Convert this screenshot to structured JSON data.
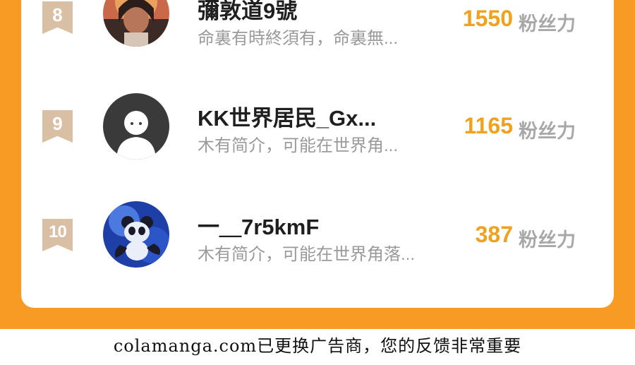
{
  "ranking": {
    "rows": [
      {
        "rank": "8",
        "name": "彌敦道9號",
        "bio": "命裏有時終須有，命裏無...",
        "count": "1550",
        "unit": "粉丝力",
        "avatar_icon": "user-photo-icon"
      },
      {
        "rank": "9",
        "name": "KK世界居民_Gx...",
        "bio": "木有简介，可能在世界角...",
        "count": "1165",
        "unit": "粉丝力",
        "avatar_icon": "default-avatar-icon"
      },
      {
        "rank": "10",
        "name": "一＿7r5kmF",
        "bio": "木有简介，可能在世界角落...",
        "count": "387",
        "unit": "粉丝力",
        "avatar_icon": "panda-avatar-icon"
      }
    ]
  },
  "footer": {
    "notice": "colamanga.com已更换广告商，您的反馈非常重要"
  },
  "colors": {
    "frame": "#f79b25",
    "count": "#f0a21e",
    "rank_badge": "#d9bfa3"
  }
}
